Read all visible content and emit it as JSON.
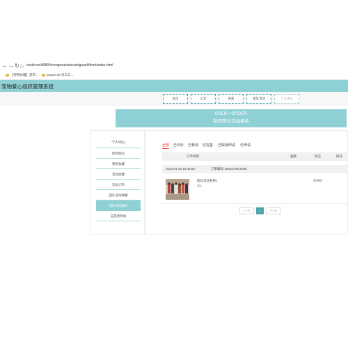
{
  "browser": {
    "nav_icons": [
      "back-icon",
      "forward-icon",
      "reload-icon",
      "home-icon"
    ],
    "nav_glyphs": [
      "←",
      "→",
      "↻",
      "⌂"
    ],
    "url": "localhost:8080/chongwuaixinzuzhiguanli/front/index.html",
    "bookmarks": [
      "【原神办理】黑市...",
      "Day02-05-员工分..."
    ]
  },
  "site": {
    "title": "宠物爱心组织管理系统"
  },
  "topnav": [
    "首页",
    "公告",
    "商家",
    "团队活动",
    "个人中心"
  ],
  "banner": {
    "line1": "USER / ORDER",
    "line2": "我的团队活动报名"
  },
  "sidebar": {
    "header": "个人中心",
    "items": [
      "修改密码",
      "我的收藏",
      "活动收藏",
      "活动订单",
      "团队活动收藏",
      "团队活动报名",
      "志愿者申请"
    ],
    "active_index": 5
  },
  "tabs": {
    "items": [
      "全部",
      "已评价",
      "已参加",
      "已完善",
      "已取消申请",
      "已申请"
    ],
    "active_index": 0
  },
  "table": {
    "headers": {
      "details": "订单详情",
      "amount": "金额",
      "status": "状态",
      "action": "操作"
    },
    "order": {
      "time": "2023-04-20 16:36:50",
      "order_no": "订单编号:1681979810090",
      "name": "团队活动名称1",
      "sub": "团队",
      "status": "已评价"
    }
  },
  "pagination": {
    "prev": "上一页",
    "current": "1",
    "next": "下一页"
  },
  "colors": {
    "accent": "#8fd0d4",
    "accent_dark": "#4da4aa",
    "active_tab": "#e2413b"
  }
}
